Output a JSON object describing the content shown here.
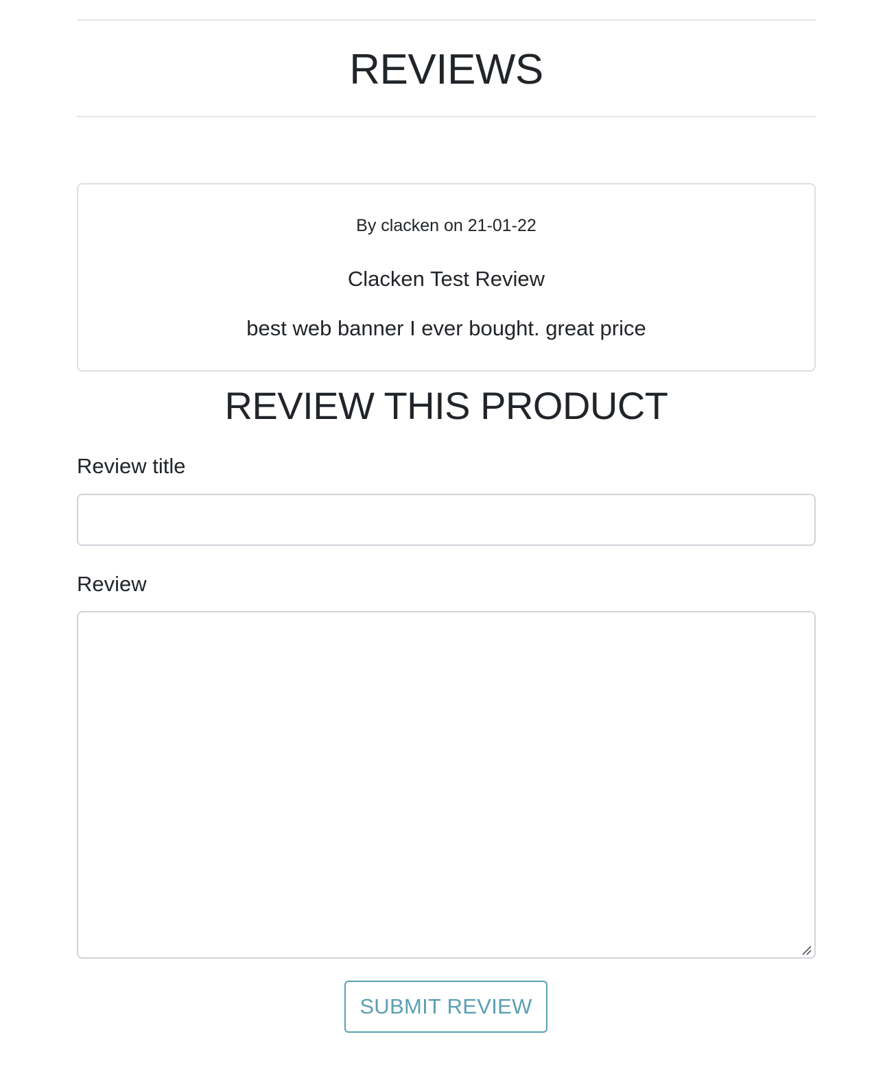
{
  "reviews_section": {
    "heading": "REVIEWS",
    "reviews": [
      {
        "meta": "By clacken on 21-01-22",
        "title": "Clacken Test Review",
        "body": "best web banner I ever bought. great price"
      }
    ]
  },
  "review_form": {
    "heading": "REVIEW THIS PRODUCT",
    "title_label": "Review title",
    "title_value": "",
    "review_label": "Review",
    "review_value": "",
    "submit_label": "SUBMIT REVIEW"
  },
  "colors": {
    "text": "#212529",
    "accent": "#5b9fb2",
    "border": "#cfd4da",
    "divider": "#e6e6e6"
  }
}
